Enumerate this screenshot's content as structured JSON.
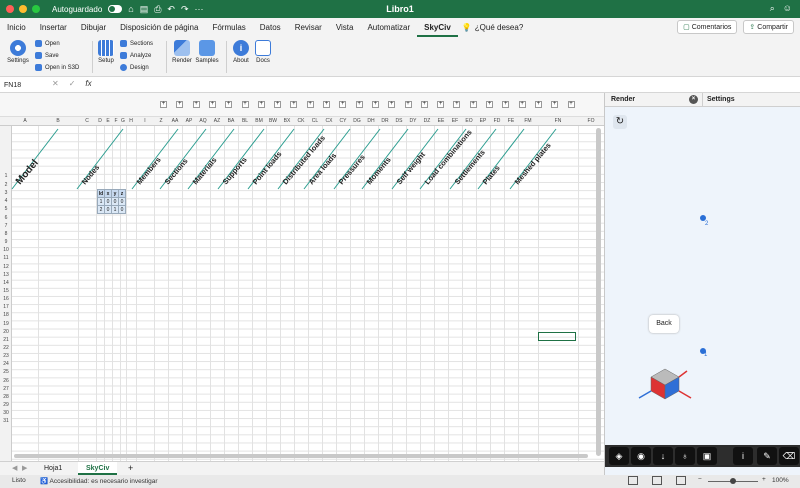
{
  "titlebar": {
    "autosave_label": "Autoguardado",
    "toggle_state": "●",
    "window_title": "Libro1",
    "search_glyph": "⌕",
    "people_glyph": "☺"
  },
  "menu": {
    "tabs": [
      "Inicio",
      "Insertar",
      "Dibujar",
      "Disposición de página",
      "Fórmulas",
      "Datos",
      "Revisar",
      "Vista",
      "Automatizar",
      "SkyCiv"
    ],
    "active_tab": "SkyCiv",
    "search_placeholder": "¿Qué desea?",
    "comments_label": "Comentarios",
    "share_label": "Compartir"
  },
  "ribbon": {
    "settings": "Settings",
    "open": "Open",
    "save": "Save",
    "open_s3d": "Open in S3D",
    "setup": "Setup",
    "sections": "Sections",
    "analyze": "Analyze",
    "design": "Design",
    "render": "Render",
    "samples": "Samples",
    "about": "About",
    "docs": "Docs"
  },
  "formula": {
    "name_box": "FN18",
    "fx": "fx",
    "cancel": "✕",
    "confirm": "✓"
  },
  "columns": [
    "A",
    "B",
    "C",
    "D",
    "E",
    "F",
    "G",
    "H",
    "I",
    "Z",
    "AA",
    "AP",
    "AQ",
    "AZ",
    "BA",
    "BL",
    "BM",
    "BW",
    "BX",
    "CK",
    "CL",
    "CX",
    "CY",
    "DG",
    "DH",
    "DR",
    "DS",
    "DY",
    "DZ",
    "EE",
    "EF",
    "EO",
    "EP",
    "FD",
    "FE",
    "FM",
    "FN",
    "FO"
  ],
  "rows": [
    "1",
    "2",
    "3",
    "4",
    "5",
    "6",
    "7",
    "8",
    "9",
    "10",
    "11",
    "12",
    "13",
    "14",
    "15",
    "16",
    "17",
    "18",
    "19",
    "20",
    "21",
    "22",
    "23",
    "24",
    "25",
    "26",
    "27",
    "28",
    "29",
    "30",
    "31"
  ],
  "headers": [
    "Model",
    "Nodes",
    "Members",
    "Sections",
    "Materials",
    "Supports",
    "Point loads",
    "Distributed loads",
    "Area loads",
    "Pressures",
    "Moments",
    "Self weight",
    "Load combinations",
    "Settlements",
    "Plates",
    "Meshed plates"
  ],
  "nodes_table": {
    "header": [
      "Id",
      "x",
      "y",
      "z"
    ],
    "rows": [
      [
        "1",
        "0",
        "0",
        "0"
      ],
      [
        "2",
        "0",
        "1",
        "0"
      ]
    ]
  },
  "outline_plus": "+",
  "sheet_tabs": [
    "Hoja1",
    "SkyCiv"
  ],
  "active_sheet": "SkyCiv",
  "add_sheet": "+",
  "status": {
    "ready": "Listo",
    "accessibility": "Accesibilidad: es necesario investigar",
    "zoom": "100%"
  },
  "panel": {
    "render_tab": "Render",
    "settings_tab": "Settings",
    "close": "×",
    "refresh": "↻",
    "back_button": "Back",
    "node_labels": [
      "2",
      "1"
    ],
    "toolbar_icons": [
      "layers-icon",
      "eye-icon",
      "download-icon",
      "bulb-icon",
      "camera-icon",
      "info-icon",
      "pencil-icon",
      "eraser-icon"
    ],
    "toolbar_glyphs": [
      "◈",
      "◉",
      "↓",
      "♁",
      "▣",
      "i",
      "✎",
      "⌫"
    ]
  },
  "colors": {
    "brand": "#1f7145",
    "node": "#2a6fd6",
    "accent": "#2f7de0"
  }
}
